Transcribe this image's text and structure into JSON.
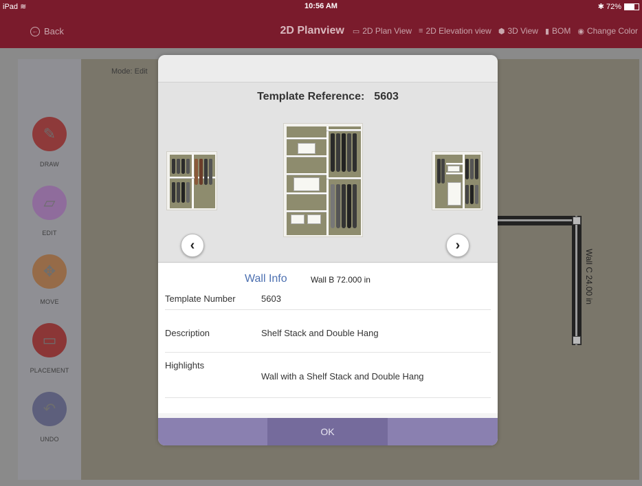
{
  "status_bar": {
    "device": "iPad",
    "time": "10:56 AM",
    "battery": "72%"
  },
  "nav": {
    "back_label": "Back",
    "title": "2D Planview",
    "items": [
      {
        "label": "2D Plan View",
        "icon": "plan-view-icon"
      },
      {
        "label": "2D Elevation view",
        "icon": "elevation-icon"
      },
      {
        "label": "3D View",
        "icon": "cube-icon"
      },
      {
        "label": "BOM",
        "icon": "document-icon"
      },
      {
        "label": "Change Color",
        "icon": "palette-icon"
      }
    ]
  },
  "workspace": {
    "mode": "Mode: Edit",
    "wall_label": "Wall C 24.00 in"
  },
  "tools": [
    {
      "label": "DRAW",
      "icon": "pencil-icon",
      "color": "#8e3a3a"
    },
    {
      "label": "EDIT",
      "icon": "ruler-icon",
      "color": "#8f6c9c"
    },
    {
      "label": "MOVE",
      "icon": "move-arrows-icon",
      "color": "#966b48"
    },
    {
      "label": "PLACEMENT",
      "icon": "placement-icon",
      "color": "#8b3636"
    },
    {
      "label": "UNDO",
      "icon": "undo-icon",
      "color": "#5d5f7c"
    }
  ],
  "modal": {
    "template_reference_label": "Template Reference:",
    "template_reference_value": "5603",
    "wall_info_label": "Wall Info",
    "wall_info_value": "Wall B 72.000 in",
    "rows": [
      {
        "label": "Template Number",
        "value": "5603"
      },
      {
        "label": "Description",
        "value": "Shelf Stack and Double Hang"
      },
      {
        "label": "Highlights",
        "value": "Wall with a Shelf Stack and Double Hang"
      }
    ],
    "ok_label": "OK"
  },
  "colors": {
    "header": "#7a1b2c",
    "accent": "#4b6fb0",
    "footer": "#8a80b0"
  }
}
